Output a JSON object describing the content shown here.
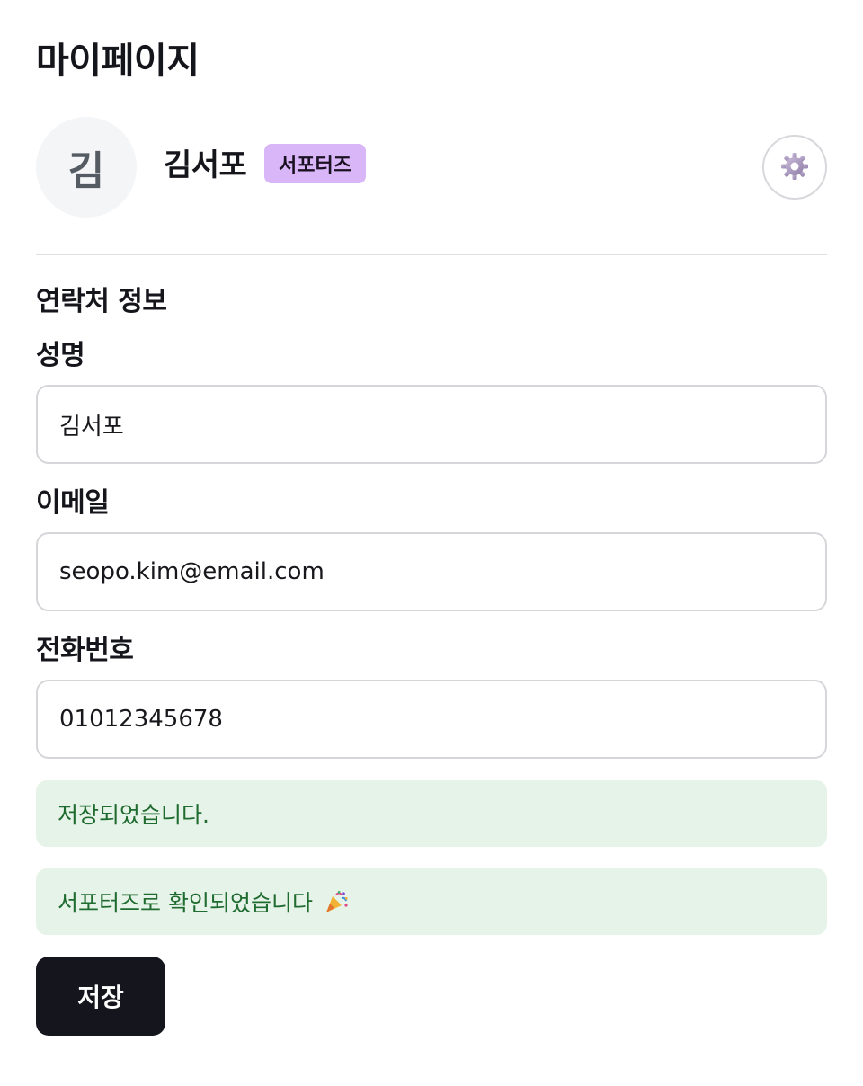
{
  "page": {
    "title": "마이페이지"
  },
  "profile": {
    "avatar_initial": "김",
    "name": "김서포",
    "badge": "서포터즈",
    "badge_color": "#d9b6f8",
    "settings_icon": "gear-icon"
  },
  "contact": {
    "section_title": "연락처 정보",
    "fields": {
      "name": {
        "label": "성명",
        "value": "김서포"
      },
      "email": {
        "label": "이메일",
        "value": "seopo.kim@email.com"
      },
      "phone": {
        "label": "전화번호",
        "value": "01012345678"
      }
    }
  },
  "notices": {
    "saved": "저장되었습니다.",
    "supporter_confirmed": "서포터즈로 확인되었습니다",
    "supporter_icon": "party-popper-icon",
    "success_bg": "#e6f3e8",
    "success_text": "#1f6b30"
  },
  "actions": {
    "save_label": "저장",
    "save_bg": "#15151e"
  }
}
